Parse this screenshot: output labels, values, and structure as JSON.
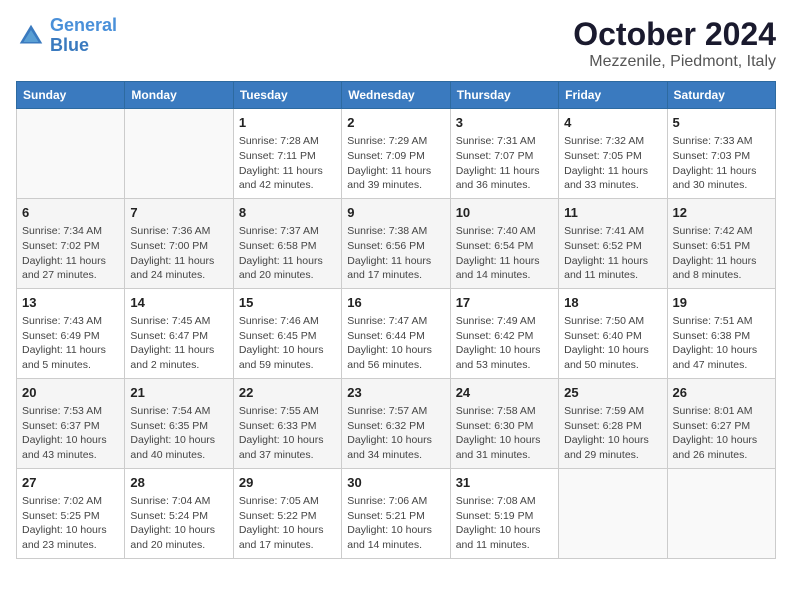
{
  "header": {
    "logo_line1": "General",
    "logo_line2": "Blue",
    "title": "October 2024",
    "subtitle": "Mezzenile, Piedmont, Italy"
  },
  "weekdays": [
    "Sunday",
    "Monday",
    "Tuesday",
    "Wednesday",
    "Thursday",
    "Friday",
    "Saturday"
  ],
  "weeks": [
    [
      {
        "day": "",
        "info": ""
      },
      {
        "day": "",
        "info": ""
      },
      {
        "day": "1",
        "info": "Sunrise: 7:28 AM\nSunset: 7:11 PM\nDaylight: 11 hours and 42 minutes."
      },
      {
        "day": "2",
        "info": "Sunrise: 7:29 AM\nSunset: 7:09 PM\nDaylight: 11 hours and 39 minutes."
      },
      {
        "day": "3",
        "info": "Sunrise: 7:31 AM\nSunset: 7:07 PM\nDaylight: 11 hours and 36 minutes."
      },
      {
        "day": "4",
        "info": "Sunrise: 7:32 AM\nSunset: 7:05 PM\nDaylight: 11 hours and 33 minutes."
      },
      {
        "day": "5",
        "info": "Sunrise: 7:33 AM\nSunset: 7:03 PM\nDaylight: 11 hours and 30 minutes."
      }
    ],
    [
      {
        "day": "6",
        "info": "Sunrise: 7:34 AM\nSunset: 7:02 PM\nDaylight: 11 hours and 27 minutes."
      },
      {
        "day": "7",
        "info": "Sunrise: 7:36 AM\nSunset: 7:00 PM\nDaylight: 11 hours and 24 minutes."
      },
      {
        "day": "8",
        "info": "Sunrise: 7:37 AM\nSunset: 6:58 PM\nDaylight: 11 hours and 20 minutes."
      },
      {
        "day": "9",
        "info": "Sunrise: 7:38 AM\nSunset: 6:56 PM\nDaylight: 11 hours and 17 minutes."
      },
      {
        "day": "10",
        "info": "Sunrise: 7:40 AM\nSunset: 6:54 PM\nDaylight: 11 hours and 14 minutes."
      },
      {
        "day": "11",
        "info": "Sunrise: 7:41 AM\nSunset: 6:52 PM\nDaylight: 11 hours and 11 minutes."
      },
      {
        "day": "12",
        "info": "Sunrise: 7:42 AM\nSunset: 6:51 PM\nDaylight: 11 hours and 8 minutes."
      }
    ],
    [
      {
        "day": "13",
        "info": "Sunrise: 7:43 AM\nSunset: 6:49 PM\nDaylight: 11 hours and 5 minutes."
      },
      {
        "day": "14",
        "info": "Sunrise: 7:45 AM\nSunset: 6:47 PM\nDaylight: 11 hours and 2 minutes."
      },
      {
        "day": "15",
        "info": "Sunrise: 7:46 AM\nSunset: 6:45 PM\nDaylight: 10 hours and 59 minutes."
      },
      {
        "day": "16",
        "info": "Sunrise: 7:47 AM\nSunset: 6:44 PM\nDaylight: 10 hours and 56 minutes."
      },
      {
        "day": "17",
        "info": "Sunrise: 7:49 AM\nSunset: 6:42 PM\nDaylight: 10 hours and 53 minutes."
      },
      {
        "day": "18",
        "info": "Sunrise: 7:50 AM\nSunset: 6:40 PM\nDaylight: 10 hours and 50 minutes."
      },
      {
        "day": "19",
        "info": "Sunrise: 7:51 AM\nSunset: 6:38 PM\nDaylight: 10 hours and 47 minutes."
      }
    ],
    [
      {
        "day": "20",
        "info": "Sunrise: 7:53 AM\nSunset: 6:37 PM\nDaylight: 10 hours and 43 minutes."
      },
      {
        "day": "21",
        "info": "Sunrise: 7:54 AM\nSunset: 6:35 PM\nDaylight: 10 hours and 40 minutes."
      },
      {
        "day": "22",
        "info": "Sunrise: 7:55 AM\nSunset: 6:33 PM\nDaylight: 10 hours and 37 minutes."
      },
      {
        "day": "23",
        "info": "Sunrise: 7:57 AM\nSunset: 6:32 PM\nDaylight: 10 hours and 34 minutes."
      },
      {
        "day": "24",
        "info": "Sunrise: 7:58 AM\nSunset: 6:30 PM\nDaylight: 10 hours and 31 minutes."
      },
      {
        "day": "25",
        "info": "Sunrise: 7:59 AM\nSunset: 6:28 PM\nDaylight: 10 hours and 29 minutes."
      },
      {
        "day": "26",
        "info": "Sunrise: 8:01 AM\nSunset: 6:27 PM\nDaylight: 10 hours and 26 minutes."
      }
    ],
    [
      {
        "day": "27",
        "info": "Sunrise: 7:02 AM\nSunset: 5:25 PM\nDaylight: 10 hours and 23 minutes."
      },
      {
        "day": "28",
        "info": "Sunrise: 7:04 AM\nSunset: 5:24 PM\nDaylight: 10 hours and 20 minutes."
      },
      {
        "day": "29",
        "info": "Sunrise: 7:05 AM\nSunset: 5:22 PM\nDaylight: 10 hours and 17 minutes."
      },
      {
        "day": "30",
        "info": "Sunrise: 7:06 AM\nSunset: 5:21 PM\nDaylight: 10 hours and 14 minutes."
      },
      {
        "day": "31",
        "info": "Sunrise: 7:08 AM\nSunset: 5:19 PM\nDaylight: 10 hours and 11 minutes."
      },
      {
        "day": "",
        "info": ""
      },
      {
        "day": "",
        "info": ""
      }
    ]
  ]
}
